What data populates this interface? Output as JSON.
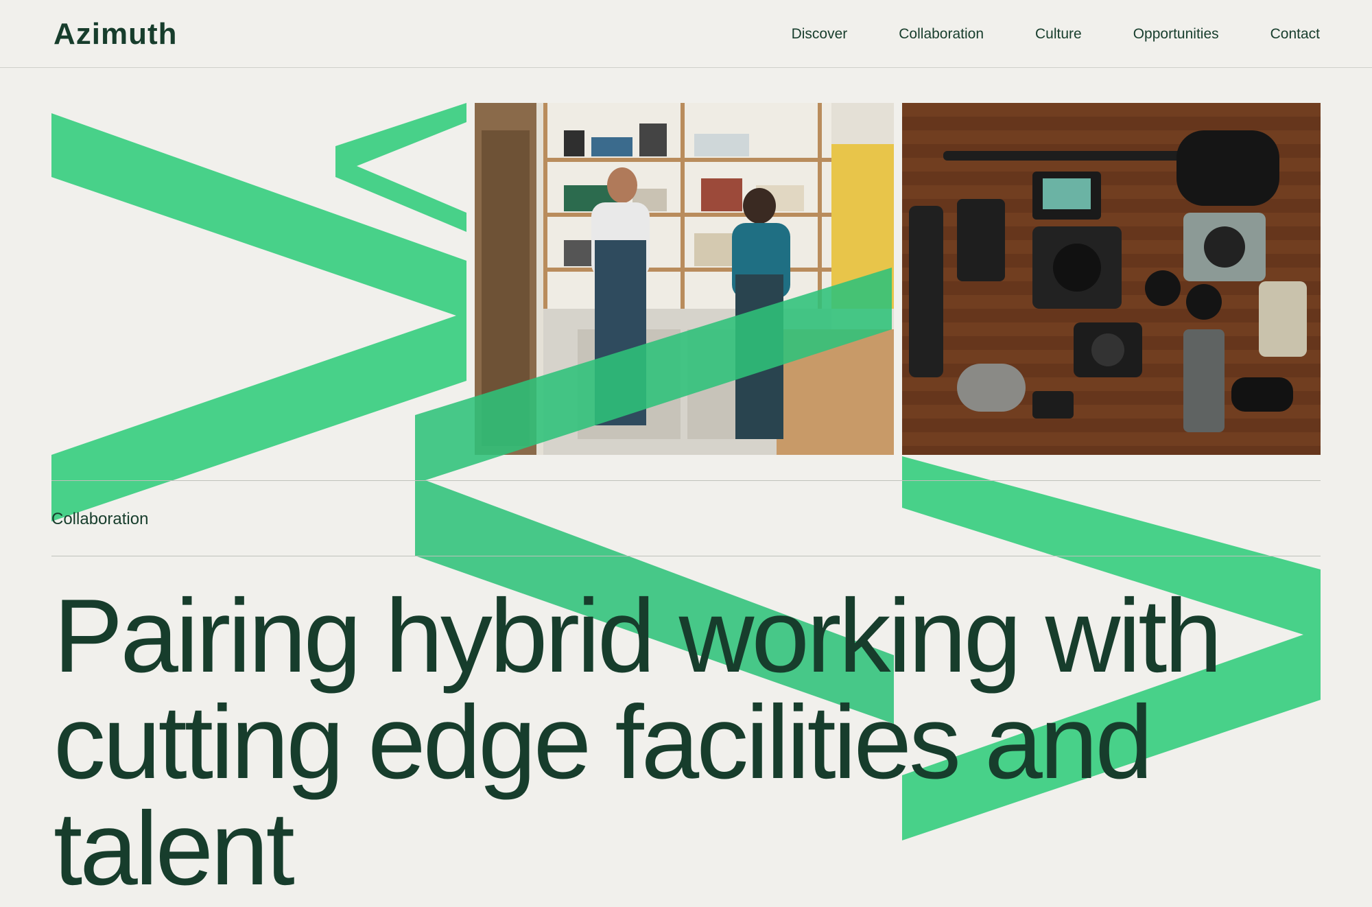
{
  "brand": {
    "logo_text": "Azimuth"
  },
  "nav": {
    "items": [
      {
        "label": "Discover"
      },
      {
        "label": "Collaboration"
      },
      {
        "label": "Culture"
      },
      {
        "label": "Opportunities"
      },
      {
        "label": "Contact"
      }
    ]
  },
  "hero": {
    "images": [
      {
        "alt": "workshop-photo"
      },
      {
        "alt": "camera-gear-photo"
      }
    ]
  },
  "section": {
    "label": "Collaboration",
    "headline": "Pairing hybrid working with cutting edge facilities and talent"
  },
  "colors": {
    "background": "#f1f0ec",
    "ink": "#173d2c",
    "accent": "#3ecf84"
  }
}
